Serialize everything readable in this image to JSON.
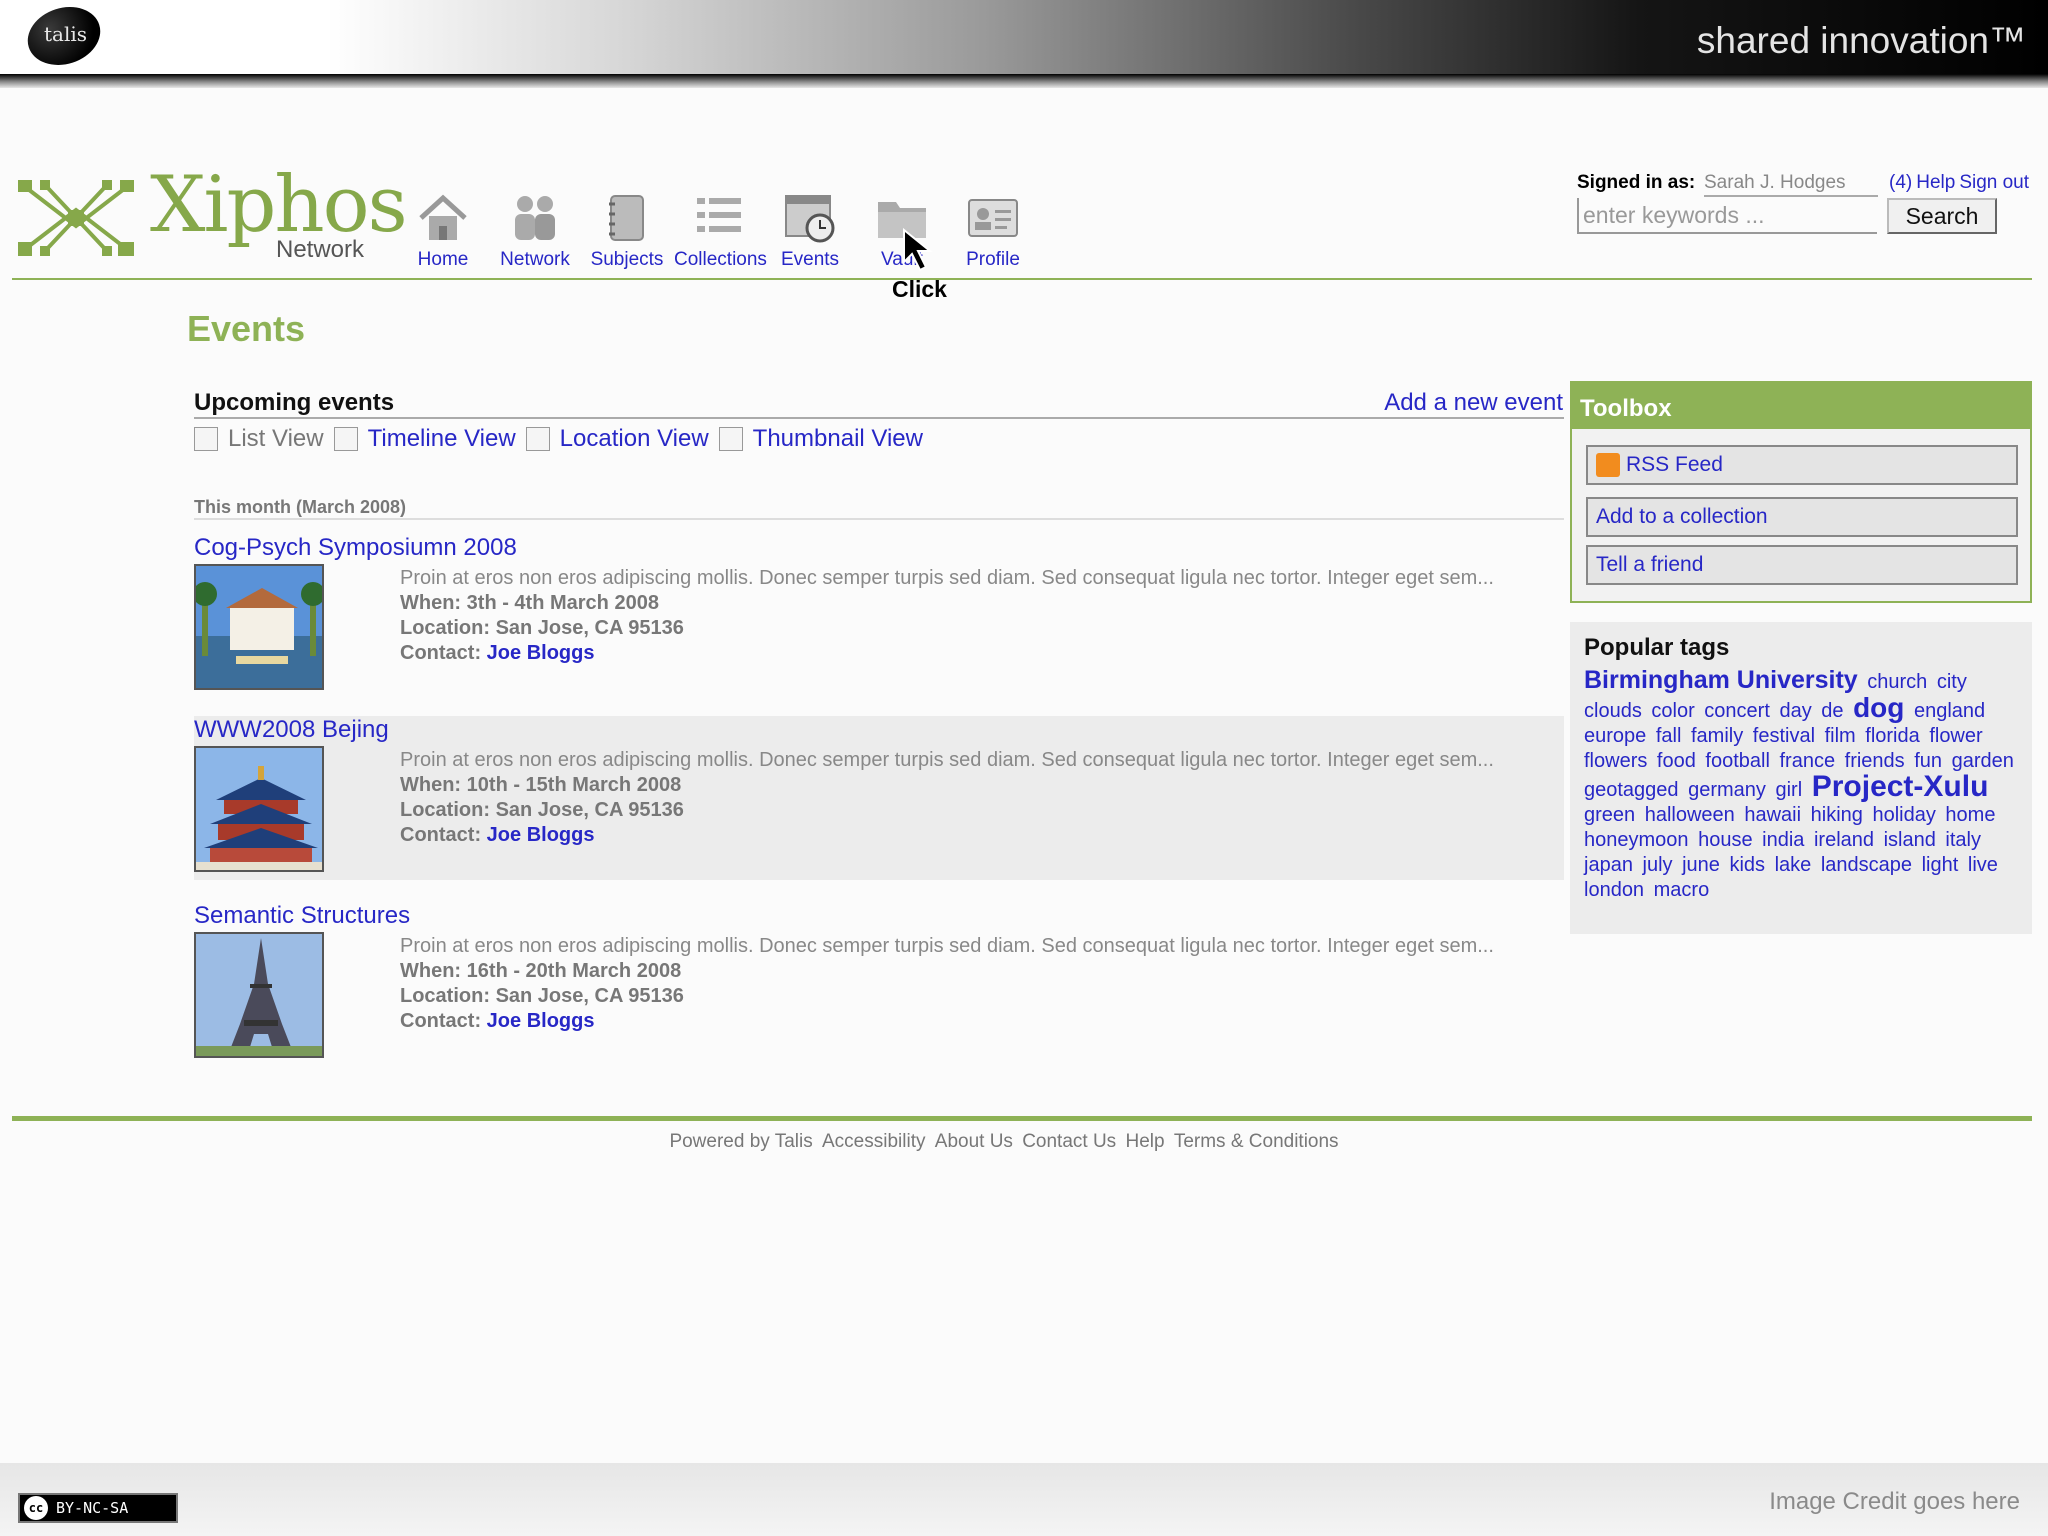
{
  "slide": {
    "brand": "talis",
    "tagline": "shared innovation™",
    "license": "BY-NC-SA",
    "license_mark": "cc",
    "credit": "Image Credit goes here"
  },
  "site": {
    "logo_word": "Xiphos",
    "logo_sub": "Network"
  },
  "nav": {
    "items": [
      {
        "label": "Home",
        "icon": "house-icon"
      },
      {
        "label": "Network",
        "icon": "people-icon"
      },
      {
        "label": "Subjects",
        "icon": "notebook-icon"
      },
      {
        "label": "Collections",
        "icon": "list-icon"
      },
      {
        "label": "Events",
        "icon": "calendar-clock-icon"
      },
      {
        "label": "Vault",
        "icon": "folder-icon"
      },
      {
        "label": "Profile",
        "icon": "id-card-icon"
      }
    ],
    "annotation": "Click"
  },
  "account": {
    "signed_in_label": "Signed in as:",
    "user": "Sarah J. Hodges",
    "messages": "(4)",
    "help": "Help",
    "sign_out": "Sign out",
    "search_placeholder": "enter keywords ...",
    "search_button": "Search"
  },
  "page": {
    "title": "Events",
    "upcoming": "Upcoming events",
    "add_event": "Add a new event",
    "views": [
      "List View",
      "Timeline View",
      "Location View",
      "Thumbnail View"
    ],
    "month": "This month (March 2008)"
  },
  "events": [
    {
      "title": "Cog-Psych Symposiumn 2008",
      "description": "Proin at eros non eros adipiscing mollis. Donec semper turpis sed diam. Sed consequat ligula nec tortor. Integer eget sem...",
      "when_label": "When:",
      "when": "3th - 4th March 2008",
      "location_label": "Location:",
      "location": "San Jose, CA 95136",
      "contact_label": "Contact:",
      "contact": "Joe Bloggs"
    },
    {
      "title": "WWW2008 Bejing",
      "description": "Proin at eros non eros adipiscing mollis. Donec semper turpis sed diam. Sed consequat ligula nec tortor. Integer eget sem...",
      "when_label": "When:",
      "when": "10th - 15th March 2008",
      "location_label": "Location:",
      "location": "San Jose, CA 95136",
      "contact_label": "Contact:",
      "contact": "Joe Bloggs"
    },
    {
      "title": "Semantic Structures",
      "description": "Proin at eros non eros adipiscing mollis. Donec semper turpis sed diam. Sed consequat ligula nec tortor. Integer eget sem...",
      "when_label": "When:",
      "when": "16th - 20th March 2008",
      "location_label": "Location:",
      "location": "San Jose, CA 95136",
      "contact_label": "Contact:",
      "contact": "Joe Bloggs"
    }
  ],
  "toolbox": {
    "title": "Toolbox",
    "buttons": [
      "RSS Feed",
      "Add to a collection",
      "Tell a friend"
    ]
  },
  "tags": {
    "title": "Popular tags",
    "list": [
      "Birmingham University",
      "church",
      "city",
      "clouds",
      "color",
      "concert",
      "day",
      "de",
      "dog",
      "england",
      "europe",
      "fall",
      "family",
      "festival",
      "film",
      "florida",
      "flower",
      "flowers",
      "food",
      "football",
      "france",
      "friends",
      "fun",
      "garden",
      "geotagged",
      "germany",
      "girl",
      "Project-Xulu",
      "green",
      "halloween",
      "hawaii",
      "hiking",
      "holiday",
      "home",
      "honeymoon",
      "house",
      "india",
      "ireland",
      "island",
      "italy",
      "japan",
      "july",
      "june",
      "kids",
      "lake",
      "landscape",
      "light",
      "live",
      "london",
      "macro"
    ]
  },
  "footer": {
    "links": [
      "Powered by Talis",
      "Accessibility",
      "About Us",
      "Contact Us",
      "Help",
      "Terms & Conditions"
    ]
  }
}
